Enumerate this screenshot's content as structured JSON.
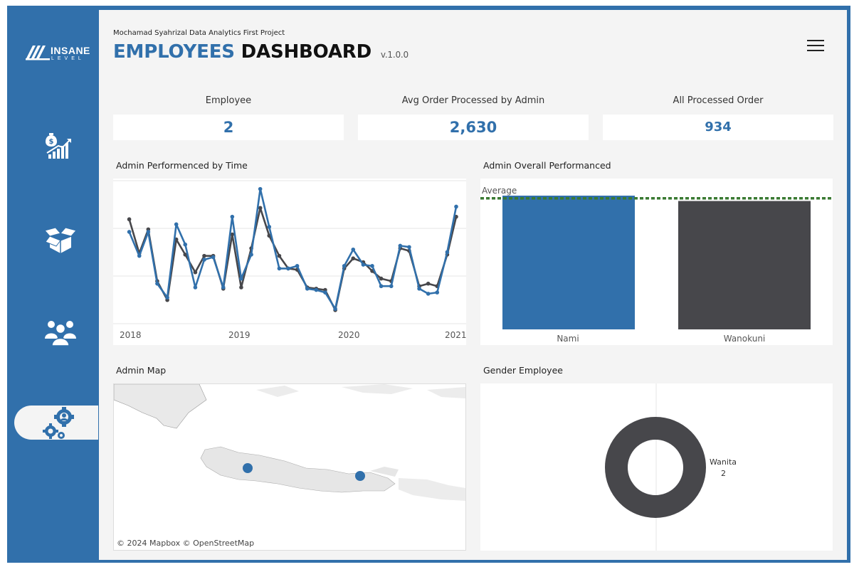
{
  "logo": {
    "word": "INSANE",
    "sub": "LEVEL"
  },
  "sidebar": {
    "items": [
      {
        "name": "sales-icon"
      },
      {
        "name": "box-icon"
      },
      {
        "name": "people-icon"
      },
      {
        "name": "admin-gear-icon",
        "active": true
      }
    ]
  },
  "header": {
    "subtitle": "Mochamad Syahrizal Data Analytics First Project",
    "title_part1": "EMPLOYEES",
    "title_part2": "DASHBOARD",
    "version": "v.1.0.0"
  },
  "kpis": [
    {
      "label": "Employee",
      "value": "2"
    },
    {
      "label": "Avg Order Processed by Admin",
      "value": "2,630"
    },
    {
      "label": "All Processed Order",
      "value": "934"
    }
  ],
  "panels": {
    "line_title": "Admin Performenced by Time",
    "bar_title": "Admin Overall Performanced",
    "map_title": "Admin Map",
    "donut_title": "Gender Employee"
  },
  "map": {
    "credit": "© 2024 Mapbox  © OpenStreetMap"
  },
  "colors": {
    "accent": "#3170ab",
    "dark": "#47474b",
    "average": "#3a7a32",
    "background": "#f4f4f4"
  },
  "chart_data": [
    {
      "type": "line",
      "title": "Admin Performenced by Time",
      "x_ticks": [
        "2018",
        "2019",
        "2020",
        "2021"
      ],
      "x": [
        2018.08,
        2018.17,
        2018.25,
        2018.33,
        2018.42,
        2018.5,
        2018.58,
        2018.67,
        2018.75,
        2018.83,
        2018.92,
        2019.0,
        2019.08,
        2019.17,
        2019.25,
        2019.33,
        2019.42,
        2019.5,
        2019.58,
        2019.67,
        2019.75,
        2019.83,
        2019.92,
        2020.0,
        2020.08,
        2020.17,
        2020.25,
        2020.33,
        2020.42,
        2020.5,
        2020.58,
        2020.67,
        2020.75,
        2020.83,
        2020.92,
        2021.0
      ],
      "series": [
        {
          "name": "",
          "color": "#47474b",
          "values": [
            85,
            58,
            77,
            36,
            21,
            69,
            57,
            43,
            56,
            56,
            30,
            73,
            31,
            62,
            94,
            72,
            56,
            46,
            45,
            31,
            30,
            29,
            13,
            46,
            54,
            51,
            44,
            38,
            36,
            62,
            60,
            32,
            34,
            32,
            57,
            87
          ]
        },
        {
          "name": "",
          "color": "#3170ab",
          "values": [
            75,
            56,
            75,
            34,
            23,
            81,
            65,
            31,
            53,
            55,
            31,
            87,
            38,
            57,
            109,
            79,
            46,
            46,
            48,
            30,
            29,
            27,
            14,
            48,
            61,
            49,
            48,
            32,
            32,
            64,
            63,
            30,
            26,
            27,
            59,
            95
          ]
        }
      ]
    },
    {
      "type": "bar",
      "title": "Admin Overall Performanced",
      "categories": [
        "Nami",
        "Wanokuni"
      ],
      "values": [
        1.0,
        0.96
      ],
      "average_label": "Average",
      "average_value": 0.98
    },
    {
      "type": "pie",
      "title": "Gender Employee",
      "slices": [
        {
          "label": "Wanita",
          "value": 2
        }
      ]
    }
  ]
}
